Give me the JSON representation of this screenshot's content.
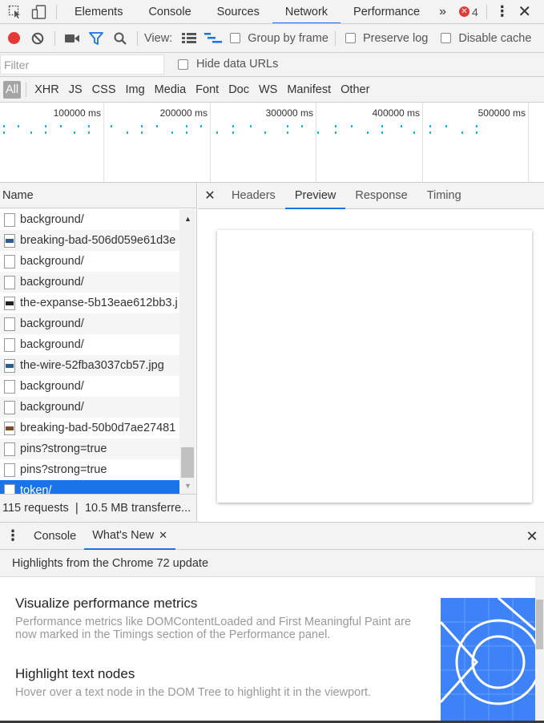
{
  "main_tabs": {
    "elements": "Elements",
    "console": "Console",
    "sources": "Sources",
    "network": "Network",
    "performance": "Performance",
    "more": "»",
    "error_count": "4"
  },
  "toolbar": {
    "view_label": "View:",
    "group_by_frame": "Group by frame",
    "preserve_log": "Preserve log",
    "disable_cache": "Disable cache"
  },
  "filter": {
    "placeholder": "Filter",
    "hide_data_urls": "Hide data URLs"
  },
  "type_filters": [
    "All",
    "XHR",
    "JS",
    "CSS",
    "Img",
    "Media",
    "Font",
    "Doc",
    "WS",
    "Manifest",
    "Other"
  ],
  "overview": {
    "ticks": [
      "100000 ms",
      "200000 ms",
      "300000 ms",
      "400000 ms",
      "500000 ms"
    ]
  },
  "requests": {
    "column_name": "Name",
    "rows": [
      {
        "name": "background/",
        "icon": "document-icon"
      },
      {
        "name": "breaking-bad-506d059e61d3e",
        "icon": "image-thumbnail-icon"
      },
      {
        "name": "background/",
        "icon": "document-icon"
      },
      {
        "name": "background/",
        "icon": "document-icon"
      },
      {
        "name": "the-expanse-5b13eae612bb3.j",
        "icon": "image-thumbnail-icon"
      },
      {
        "name": "background/",
        "icon": "document-icon"
      },
      {
        "name": "background/",
        "icon": "document-icon"
      },
      {
        "name": "the-wire-52fba3037cb57.jpg",
        "icon": "image-thumbnail-icon"
      },
      {
        "name": "background/",
        "icon": "document-icon"
      },
      {
        "name": "background/",
        "icon": "document-icon"
      },
      {
        "name": "breaking-bad-50b0d7ae27481",
        "icon": "image-thumbnail-icon"
      },
      {
        "name": "pins?strong=true",
        "icon": "document-icon"
      },
      {
        "name": "pins?strong=true",
        "icon": "document-icon"
      },
      {
        "name": "token/",
        "icon": "document-icon"
      }
    ],
    "selected_index": 13,
    "status": "115 requests  ❘  10.5 MB transferre..."
  },
  "detail_tabs": [
    "Headers",
    "Preview",
    "Response",
    "Timing"
  ],
  "detail_active": "Preview",
  "drawer": {
    "console_tab": "Console",
    "whats_new_tab": "What's New",
    "highlights": "Highlights from the Chrome 72 update",
    "features": [
      {
        "title": "Visualize performance metrics",
        "desc": "Performance metrics like DOMContentLoaded and First Meaningful Paint are now marked in the Timings section of the Performance panel."
      },
      {
        "title": "Highlight text nodes",
        "desc": "Hover over a text node in the DOM Tree to highlight it in the viewport."
      }
    ]
  },
  "colors": {
    "accent": "#1a73e8",
    "record": "#e53935",
    "error": "#e53935",
    "timeline_tick": "#1bb3d7",
    "feature_art": "#3e82f7"
  }
}
